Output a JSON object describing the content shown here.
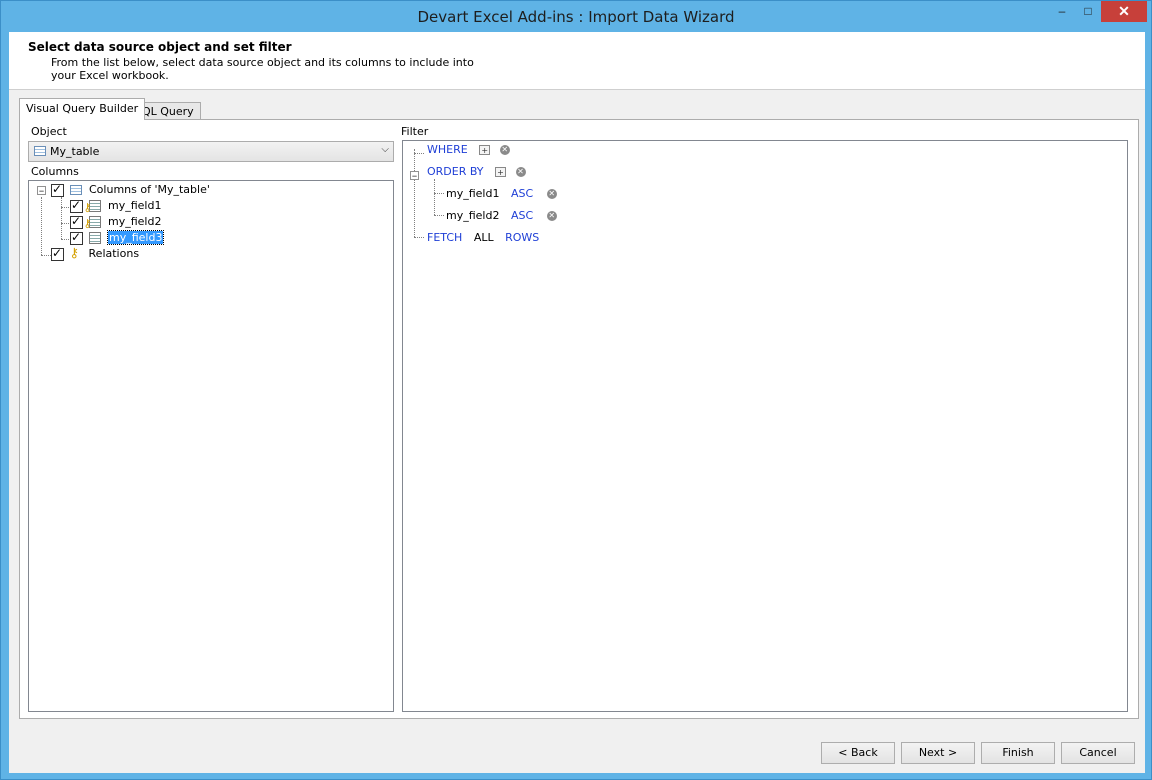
{
  "window": {
    "title": "Devart Excel Add-ins : Import Data Wizard",
    "minimize": "–",
    "maximize": "□",
    "close": "✕"
  },
  "header": {
    "title": "Select data source object and set filter",
    "description": "From the list below, select data source object and its columns to include into your Excel workbook."
  },
  "tabs": [
    {
      "label": "Visual Query Builder",
      "active": true
    },
    {
      "label": "SQL Query",
      "active": false
    }
  ],
  "object": {
    "label": "Object",
    "value": "My_table"
  },
  "columns": {
    "label": "Columns",
    "root": "Columns of 'My_table'",
    "fields": [
      {
        "name": "my_field1",
        "checked": true,
        "key": true
      },
      {
        "name": "my_field2",
        "checked": true,
        "key": true
      },
      {
        "name": "my_field3",
        "checked": true,
        "key": false,
        "selected": true
      }
    ],
    "relations": "Relations"
  },
  "filter": {
    "label": "Filter",
    "where": "WHERE",
    "order_by": "ORDER BY",
    "order_items": [
      {
        "field": "my_field1",
        "dir": "ASC"
      },
      {
        "field": "my_field2",
        "dir": "ASC"
      }
    ],
    "fetch": "FETCH",
    "fetch_all": "ALL",
    "fetch_rows": "ROWS"
  },
  "buttons": {
    "back": "< Back",
    "next": "Next >",
    "finish": "Finish",
    "cancel": "Cancel"
  }
}
